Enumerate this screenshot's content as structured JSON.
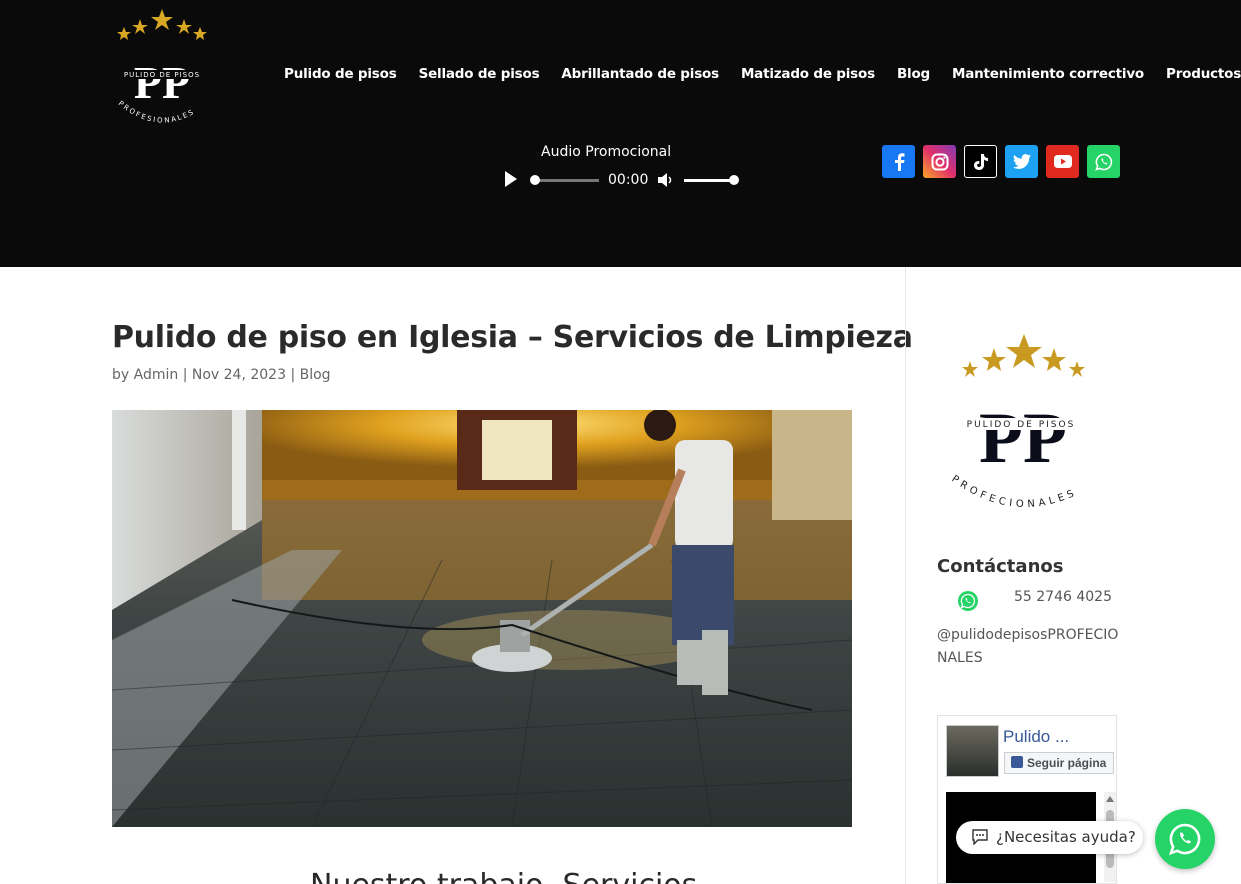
{
  "header": {
    "nav": [
      "Pulido de pisos",
      "Sellado de pisos",
      "Abrillantado de pisos",
      "Matizado de pisos",
      "Blog",
      "Mantenimiento correctivo",
      "Productos"
    ],
    "audio": {
      "title": "Audio Promocional",
      "time": "00:00"
    },
    "social": [
      "facebook-icon",
      "instagram-icon",
      "tiktok-icon",
      "twitter-icon",
      "youtube-icon",
      "whatsapp-icon"
    ]
  },
  "logo": {
    "brand": "PP",
    "line1": "PULIDO DE PISOS",
    "line2": "PROFESIONALES",
    "sidebar_line2": "PROFECIONALES"
  },
  "post": {
    "title": "Pulido de piso en Iglesia – Servicios de Limpieza",
    "meta_prefix": "by ",
    "author": "Admin",
    "date": "Nov 24, 2023",
    "category": "Blog",
    "subheading_partial": "Nuestro trabajo, Servicios"
  },
  "sidebar": {
    "contact_heading": "Contáctanos",
    "phone": "55 2746 4025",
    "handle": "@pulidodepisosPROFECIONALES",
    "fb_name": "Pulido ...",
    "fb_follow": "Seguir página"
  },
  "chat": {
    "help_text": "¿Necesitas ayuda?"
  },
  "colors": {
    "header_bg": "#0a0a0a",
    "gold": "#d4a21a",
    "facebook": "#1877f2",
    "twitter": "#1da1f2",
    "youtube": "#e02a20",
    "whatsapp": "#25d366"
  }
}
